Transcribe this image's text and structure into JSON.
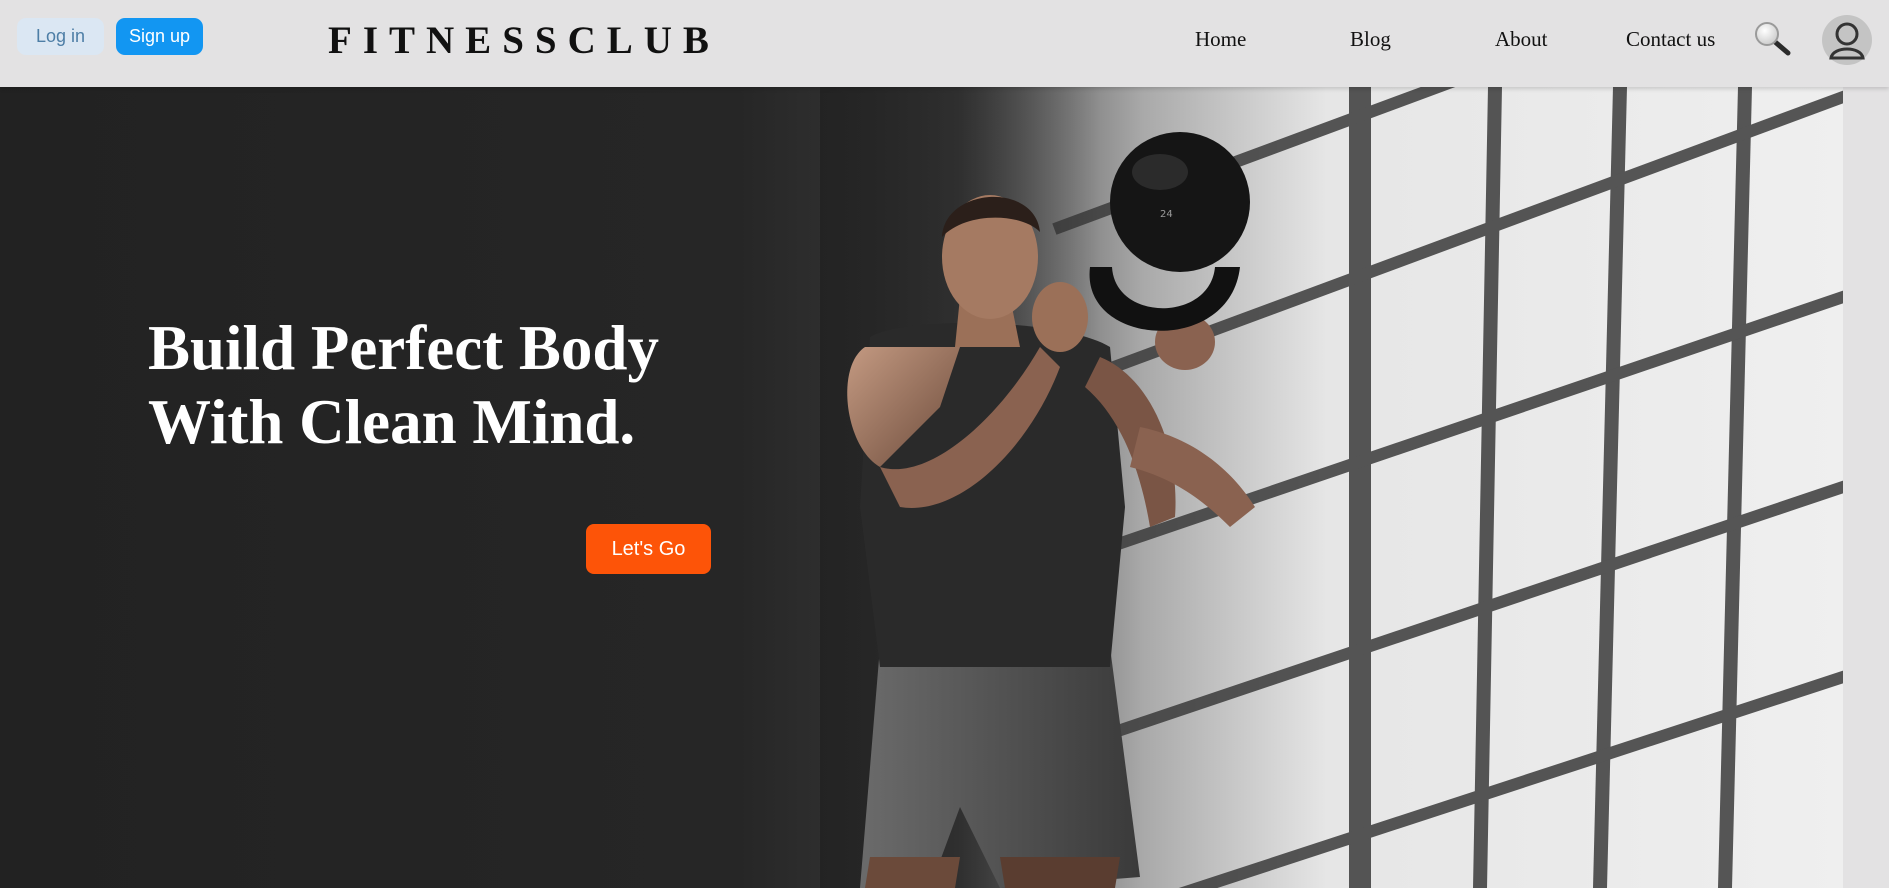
{
  "header": {
    "login_label": "Log in",
    "signup_label": "Sign up",
    "brand": "FITNESSCLUB",
    "nav": [
      {
        "label": "Home"
      },
      {
        "label": "Blog"
      },
      {
        "label": "About"
      },
      {
        "label": "Contact us"
      }
    ],
    "search_icon": "search-icon",
    "avatar_icon": "user-avatar-icon"
  },
  "hero": {
    "title_line1": "Build Perfect Body",
    "title_line2": "With Clean Mind.",
    "cta_label": "Let's Go",
    "image": "man-holding-kettlebell-photo"
  },
  "colors": {
    "header_bg": "#e3e2e3",
    "login_bg": "#dbe7f3",
    "signup_bg": "#1296f2",
    "cta_bg": "#fd5408",
    "hero_dark": "#222222"
  }
}
